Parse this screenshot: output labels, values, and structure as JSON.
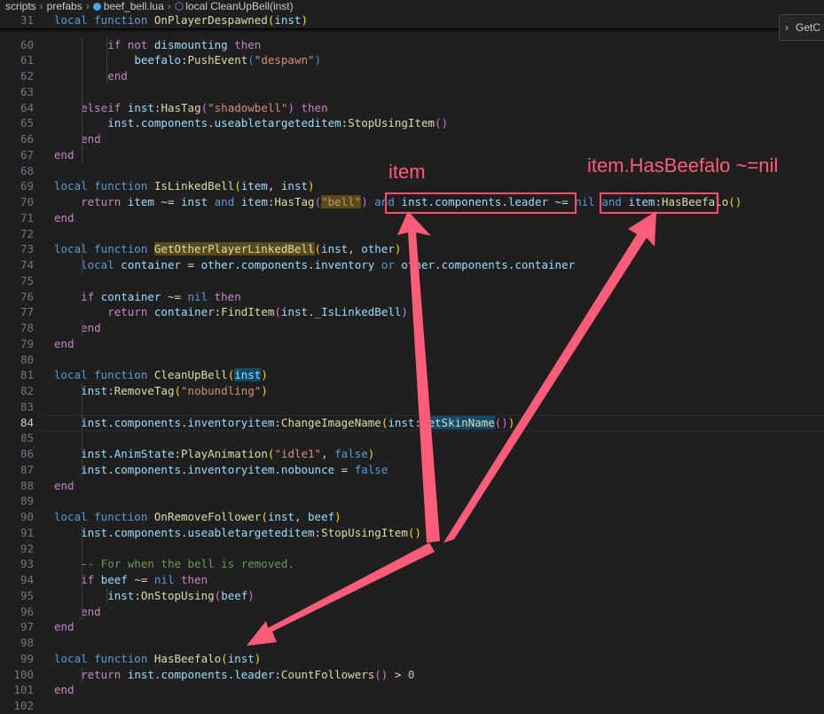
{
  "breadcrumb": {
    "items": [
      "scripts",
      "prefabs",
      "beef_bell.lua",
      "local CleanUpBell(inst)"
    ]
  },
  "find_widget": {
    "label": "GetC"
  },
  "editor": {
    "active_line": "84",
    "sticky_line": {
      "num": "31",
      "tokens": [
        [
          "k",
          "local function "
        ],
        [
          "f",
          "OnPlayerDespawned"
        ],
        [
          "b1",
          "("
        ],
        [
          "v",
          "inst"
        ],
        [
          "b1",
          ")"
        ]
      ]
    },
    "lines": [
      {
        "num": "60",
        "tokens": [
          [
            "t",
            "        "
          ],
          [
            "kc",
            "if not "
          ],
          [
            "v",
            "dismounting"
          ],
          [
            "kc",
            " then"
          ]
        ]
      },
      {
        "num": "61",
        "tokens": [
          [
            "t",
            "            "
          ],
          [
            "v",
            "beefalo"
          ],
          [
            "o",
            ":"
          ],
          [
            "f",
            "PushEvent"
          ],
          [
            "b3",
            "("
          ],
          [
            "s",
            "\"despawn\""
          ],
          [
            "b3",
            ")"
          ]
        ]
      },
      {
        "num": "62",
        "tokens": [
          [
            "t",
            "        "
          ],
          [
            "kc",
            "end"
          ]
        ]
      },
      {
        "num": "63",
        "tokens": []
      },
      {
        "num": "64",
        "tokens": [
          [
            "t",
            "    "
          ],
          [
            "kc",
            "elseif "
          ],
          [
            "v",
            "inst"
          ],
          [
            "o",
            ":"
          ],
          [
            "f",
            "HasTag"
          ],
          [
            "b2",
            "("
          ],
          [
            "s",
            "\"shadowbell\""
          ],
          [
            "b2",
            ")"
          ],
          [
            "kc",
            " then"
          ]
        ]
      },
      {
        "num": "65",
        "tokens": [
          [
            "t",
            "        "
          ],
          [
            "v",
            "inst"
          ],
          [
            "o",
            "."
          ],
          [
            "v",
            "components"
          ],
          [
            "o",
            "."
          ],
          [
            "v",
            "useabletargeteditem"
          ],
          [
            "o",
            ":"
          ],
          [
            "f",
            "StopUsingItem"
          ],
          [
            "b2",
            "()"
          ]
        ]
      },
      {
        "num": "66",
        "tokens": [
          [
            "t",
            "    "
          ],
          [
            "kc",
            "end"
          ]
        ]
      },
      {
        "num": "67",
        "tokens": [
          [
            "kc",
            "end"
          ]
        ]
      },
      {
        "num": "68",
        "tokens": []
      },
      {
        "num": "69",
        "tokens": [
          [
            "k",
            "local function "
          ],
          [
            "f",
            "IsLinkedBell"
          ],
          [
            "b1",
            "("
          ],
          [
            "v",
            "item"
          ],
          [
            "o",
            ", "
          ],
          [
            "v",
            "inst"
          ],
          [
            "b1",
            ")"
          ]
        ]
      },
      {
        "num": "70",
        "tokens": [
          [
            "t",
            "    "
          ],
          [
            "kc",
            "return "
          ],
          [
            "v",
            "item"
          ],
          [
            "o",
            " ~= "
          ],
          [
            "v",
            "inst"
          ],
          [
            "k",
            " and "
          ],
          [
            "v",
            "item"
          ],
          [
            "o",
            ":"
          ],
          [
            "f",
            "HasTag"
          ],
          [
            "b2",
            "("
          ],
          [
            "s selbg",
            "\"bell\""
          ],
          [
            "b2",
            ")"
          ],
          [
            "k",
            " and "
          ],
          [
            "v",
            "inst"
          ],
          [
            "o",
            "."
          ],
          [
            "v",
            "components"
          ],
          [
            "o",
            "."
          ],
          [
            "v",
            "leader"
          ],
          [
            "o",
            " ~= "
          ],
          [
            "k",
            "nil"
          ],
          [
            "k",
            " and "
          ],
          [
            "v",
            "item"
          ],
          [
            "o",
            ":"
          ],
          [
            "f",
            "HasBeefalo"
          ],
          [
            "b1",
            "()"
          ]
        ]
      },
      {
        "num": "71",
        "tokens": [
          [
            "kc",
            "end"
          ]
        ]
      },
      {
        "num": "72",
        "tokens": []
      },
      {
        "num": "73",
        "tokens": [
          [
            "k",
            "local function "
          ],
          [
            "f selbg",
            "GetOtherPlayerLinkedBell"
          ],
          [
            "b1",
            "("
          ],
          [
            "v",
            "inst"
          ],
          [
            "o",
            ", "
          ],
          [
            "v",
            "other"
          ],
          [
            "b1",
            ")"
          ]
        ]
      },
      {
        "num": "74",
        "tokens": [
          [
            "t",
            "    "
          ],
          [
            "k",
            "local "
          ],
          [
            "v",
            "container"
          ],
          [
            "o",
            " = "
          ],
          [
            "v",
            "other"
          ],
          [
            "o",
            "."
          ],
          [
            "v",
            "components"
          ],
          [
            "o",
            "."
          ],
          [
            "v",
            "inventory"
          ],
          [
            "k",
            " or "
          ],
          [
            "v",
            "other"
          ],
          [
            "o",
            "."
          ],
          [
            "v",
            "components"
          ],
          [
            "o",
            "."
          ],
          [
            "v",
            "container"
          ]
        ]
      },
      {
        "num": "75",
        "tokens": []
      },
      {
        "num": "76",
        "tokens": [
          [
            "t",
            "    "
          ],
          [
            "kc",
            "if "
          ],
          [
            "v",
            "container"
          ],
          [
            "o",
            " ~= "
          ],
          [
            "k",
            "nil"
          ],
          [
            "kc",
            " then"
          ]
        ]
      },
      {
        "num": "77",
        "tokens": [
          [
            "t",
            "        "
          ],
          [
            "kc",
            "return "
          ],
          [
            "v",
            "container"
          ],
          [
            "o",
            ":"
          ],
          [
            "f",
            "FindItem"
          ],
          [
            "b2",
            "("
          ],
          [
            "v",
            "inst"
          ],
          [
            "o",
            "."
          ],
          [
            "v",
            "_IsLinkedBell"
          ],
          [
            "b2",
            ")"
          ]
        ]
      },
      {
        "num": "78",
        "tokens": [
          [
            "t",
            "    "
          ],
          [
            "kc",
            "end"
          ]
        ]
      },
      {
        "num": "79",
        "tokens": [
          [
            "kc",
            "end"
          ]
        ]
      },
      {
        "num": "80",
        "tokens": []
      },
      {
        "num": "81",
        "tokens": [
          [
            "k",
            "local function "
          ],
          [
            "f",
            "CleanUpBell"
          ],
          [
            "b1",
            "("
          ],
          [
            "v wordhl",
            "inst"
          ],
          [
            "b1",
            ")"
          ]
        ]
      },
      {
        "num": "82",
        "tokens": [
          [
            "t",
            "    "
          ],
          [
            "v",
            "inst"
          ],
          [
            "o",
            ":"
          ],
          [
            "f",
            "RemoveTag"
          ],
          [
            "b1",
            "("
          ],
          [
            "s",
            "\"nobundling\""
          ],
          [
            "b1",
            ")"
          ]
        ]
      },
      {
        "num": "83",
        "tokens": []
      },
      {
        "num": "84",
        "tokens": [
          [
            "t",
            "    "
          ],
          [
            "v",
            "inst"
          ],
          [
            "o",
            "."
          ],
          [
            "v",
            "components"
          ],
          [
            "o",
            "."
          ],
          [
            "v",
            "inventoryitem"
          ],
          [
            "o",
            ":"
          ],
          [
            "f",
            "ChangeImageName"
          ],
          [
            "b1",
            "("
          ],
          [
            "v",
            "inst"
          ],
          [
            "o",
            ":"
          ],
          [
            "f wordhl",
            "GetSkinName"
          ],
          [
            "b2",
            "()"
          ],
          [
            "b1",
            ")"
          ]
        ]
      },
      {
        "num": "85",
        "tokens": []
      },
      {
        "num": "86",
        "tokens": [
          [
            "t",
            "    "
          ],
          [
            "v",
            "inst"
          ],
          [
            "o",
            "."
          ],
          [
            "v",
            "AnimState"
          ],
          [
            "o",
            ":"
          ],
          [
            "f",
            "PlayAnimation"
          ],
          [
            "b1",
            "("
          ],
          [
            "s",
            "\"idle1\""
          ],
          [
            "o",
            ", "
          ],
          [
            "k",
            "false"
          ],
          [
            "b1",
            ")"
          ]
        ]
      },
      {
        "num": "87",
        "tokens": [
          [
            "t",
            "    "
          ],
          [
            "v",
            "inst"
          ],
          [
            "o",
            "."
          ],
          [
            "v",
            "components"
          ],
          [
            "o",
            "."
          ],
          [
            "v",
            "inventoryitem"
          ],
          [
            "o",
            "."
          ],
          [
            "v",
            "nobounce"
          ],
          [
            "o",
            " = "
          ],
          [
            "k",
            "false"
          ]
        ]
      },
      {
        "num": "88",
        "tokens": [
          [
            "kc",
            "end"
          ]
        ]
      },
      {
        "num": "89",
        "tokens": []
      },
      {
        "num": "90",
        "tokens": [
          [
            "k",
            "local function "
          ],
          [
            "f",
            "OnRemoveFollower"
          ],
          [
            "b1",
            "("
          ],
          [
            "v",
            "inst"
          ],
          [
            "o",
            ", "
          ],
          [
            "v",
            "beef"
          ],
          [
            "b1",
            ")"
          ]
        ]
      },
      {
        "num": "91",
        "tokens": [
          [
            "t",
            "    "
          ],
          [
            "v",
            "inst"
          ],
          [
            "o",
            "."
          ],
          [
            "v",
            "components"
          ],
          [
            "o",
            "."
          ],
          [
            "v",
            "useabletargeteditem"
          ],
          [
            "o",
            ":"
          ],
          [
            "f",
            "StopUsingItem"
          ],
          [
            "b1",
            "()"
          ]
        ]
      },
      {
        "num": "92",
        "tokens": []
      },
      {
        "num": "93",
        "tokens": [
          [
            "t",
            "    "
          ],
          [
            "c",
            "-- For when the bell is removed."
          ]
        ]
      },
      {
        "num": "94",
        "tokens": [
          [
            "t",
            "    "
          ],
          [
            "kc",
            "if "
          ],
          [
            "v",
            "beef"
          ],
          [
            "o",
            " ~= "
          ],
          [
            "k",
            "nil"
          ],
          [
            "kc",
            " then"
          ]
        ]
      },
      {
        "num": "95",
        "tokens": [
          [
            "t",
            "        "
          ],
          [
            "v",
            "inst"
          ],
          [
            "o",
            ":"
          ],
          [
            "f",
            "OnStopUsing"
          ],
          [
            "b2",
            "("
          ],
          [
            "v",
            "beef"
          ],
          [
            "b2",
            ")"
          ]
        ]
      },
      {
        "num": "96",
        "tokens": [
          [
            "t",
            "    "
          ],
          [
            "kc",
            "end"
          ]
        ]
      },
      {
        "num": "97",
        "tokens": [
          [
            "kc",
            "end"
          ]
        ]
      },
      {
        "num": "98",
        "tokens": []
      },
      {
        "num": "99",
        "tokens": [
          [
            "k",
            "local function "
          ],
          [
            "f",
            "HasBeefalo"
          ],
          [
            "b1",
            "("
          ],
          [
            "v",
            "inst"
          ],
          [
            "b1",
            ")"
          ]
        ]
      },
      {
        "num": "100",
        "tokens": [
          [
            "t",
            "    "
          ],
          [
            "kc",
            "return "
          ],
          [
            "v",
            "inst"
          ],
          [
            "o",
            "."
          ],
          [
            "v",
            "components"
          ],
          [
            "o",
            "."
          ],
          [
            "v",
            "leader"
          ],
          [
            "o",
            ":"
          ],
          [
            "f",
            "CountFollowers"
          ],
          [
            "b2",
            "()"
          ],
          [
            "o",
            " > "
          ],
          [
            "n",
            "0"
          ]
        ]
      },
      {
        "num": "101",
        "tokens": [
          [
            "kc",
            "end"
          ]
        ]
      },
      {
        "num": "102",
        "tokens": []
      }
    ]
  },
  "annotations": {
    "label_item": "item",
    "label_hasbeefalo": "item.HasBeefalo ~=nil",
    "color": "#ff4d6d"
  }
}
